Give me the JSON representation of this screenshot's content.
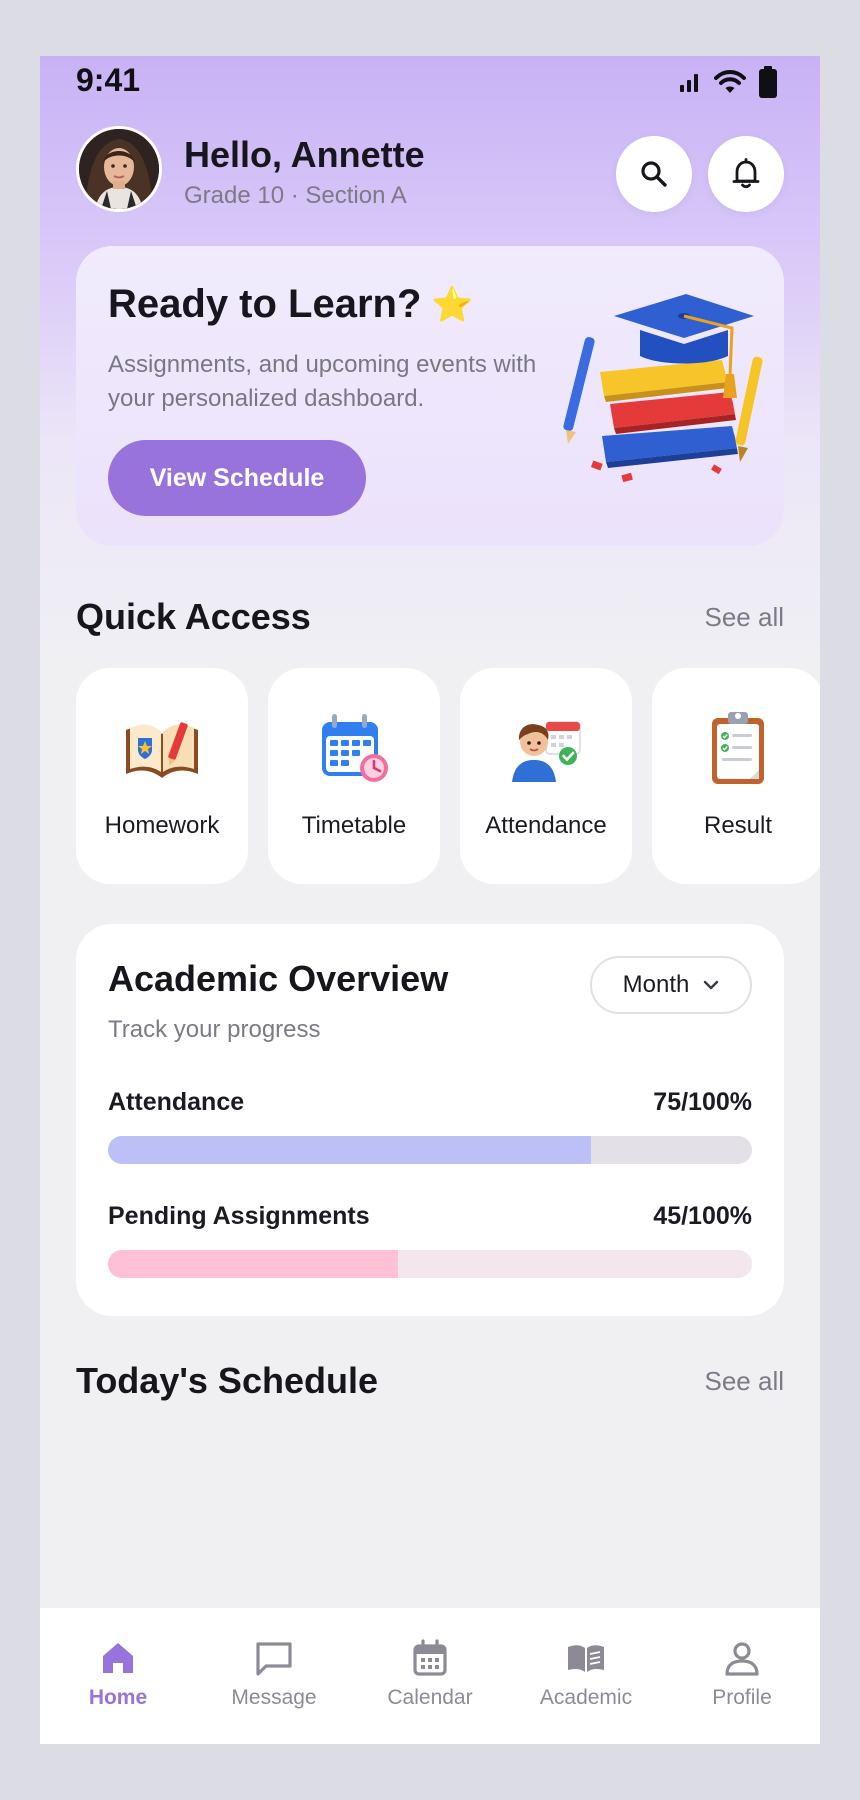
{
  "status_bar": {
    "time": "9:41"
  },
  "header": {
    "greeting": "Hello, Annette",
    "subtitle": "Grade 10 · Section A"
  },
  "hero": {
    "title": "Ready to Learn?",
    "title_emoji": "⭐",
    "description": "Assignments, and upcoming events with your personalized dashboard.",
    "button_label": "View Schedule"
  },
  "quick_access": {
    "title": "Quick Access",
    "see_all": "See all",
    "items": [
      {
        "label": "Homework",
        "icon": "homework-book-icon"
      },
      {
        "label": "Timetable",
        "icon": "timetable-calendar-icon"
      },
      {
        "label": "Attendance",
        "icon": "attendance-student-icon"
      },
      {
        "label": "Result",
        "icon": "result-clipboard-icon"
      }
    ]
  },
  "academic_overview": {
    "title": "Academic Overview",
    "subtitle": "Track your progress",
    "period_select": "Month",
    "metrics": [
      {
        "label": "Attendance",
        "value_text": "75/100%",
        "value": 75,
        "fill_color": "#bcc0f6",
        "track_color": "#e4e0e7"
      },
      {
        "label": "Pending Assignments",
        "value_text": "45/100%",
        "value": 45,
        "fill_color": "#fdc0d5",
        "track_color": "#f3e6ec"
      }
    ]
  },
  "schedule": {
    "title": "Today's Schedule",
    "see_all": "See all"
  },
  "bottom_nav": {
    "items": [
      {
        "label": "Home",
        "icon": "home-icon",
        "active": true
      },
      {
        "label": "Message",
        "icon": "message-icon",
        "active": false
      },
      {
        "label": "Calendar",
        "icon": "calendar-icon",
        "active": false
      },
      {
        "label": "Academic",
        "icon": "book-icon",
        "active": false
      },
      {
        "label": "Profile",
        "icon": "profile-icon",
        "active": false
      }
    ]
  },
  "colors": {
    "accent": "#9873dc",
    "background": "#f0f0f3",
    "header_gradient_top": "#c8b2f6",
    "text_primary": "#17161c",
    "text_secondary": "#7d7a86"
  }
}
